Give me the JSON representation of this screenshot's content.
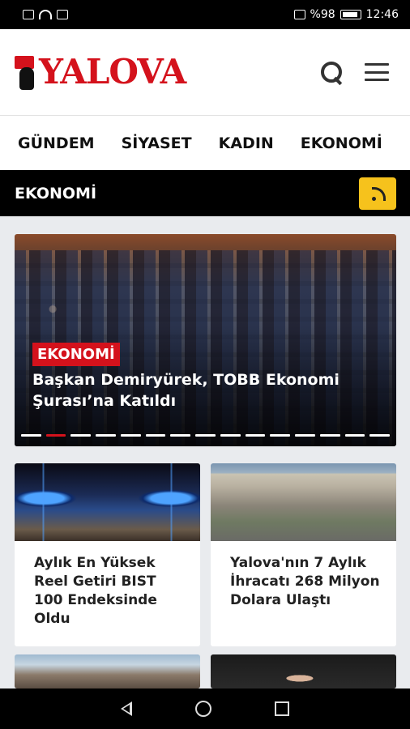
{
  "status": {
    "battery": "%98",
    "time": "12:46"
  },
  "header": {
    "logo_text": "YALOVA"
  },
  "nav": {
    "items": [
      "GÜNDEM",
      "SİYASET",
      "KADIN",
      "EKONOMİ"
    ]
  },
  "section": {
    "title": "EKONOMİ"
  },
  "slider": {
    "badge": "EKONOMİ",
    "title": "Başkan Demiryürek, TOBB Ekonomi Şurası’na Katıldı",
    "slide_count": 15,
    "active_index": 1
  },
  "cards": [
    {
      "title": "Aylık En Yüksek Reel Getiri BIST 100 Endeksinde Oldu"
    },
    {
      "title": "Yalova'nın 7 Aylık İhracatı 268 Milyon Dolara Ulaştı"
    }
  ]
}
